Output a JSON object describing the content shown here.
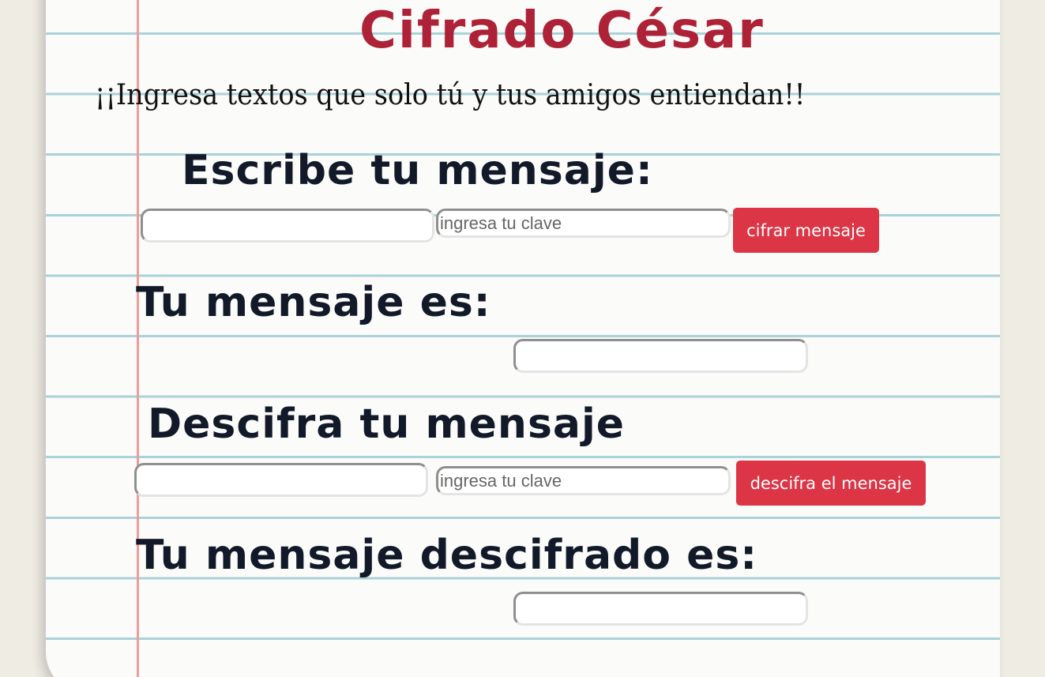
{
  "header": {
    "title": "Cifrado César",
    "subtitle": "¡¡Ingresa textos que solo tú y tus amigos entiendan!!"
  },
  "encrypt": {
    "heading": "Escribe tu mensaje:",
    "message_value": "",
    "key_placeholder": "ingresa tu clave",
    "button_label": "cifrar mensaje"
  },
  "encrypted_result": {
    "heading": "Tu mensaje es:",
    "value": ""
  },
  "decrypt": {
    "heading": "Descifra tu mensaje",
    "message_value": "",
    "key_placeholder": "ingresa tu clave",
    "button_label": "descifra el mensaje"
  },
  "decrypted_result": {
    "heading": "Tu mensaje descifrado es:",
    "value": ""
  },
  "colors": {
    "title": "#ad2236",
    "button": "#dc3545",
    "heading": "#121a2a",
    "notebook_line": "#a9d2d9",
    "margin_line": "#ee9c9a"
  }
}
